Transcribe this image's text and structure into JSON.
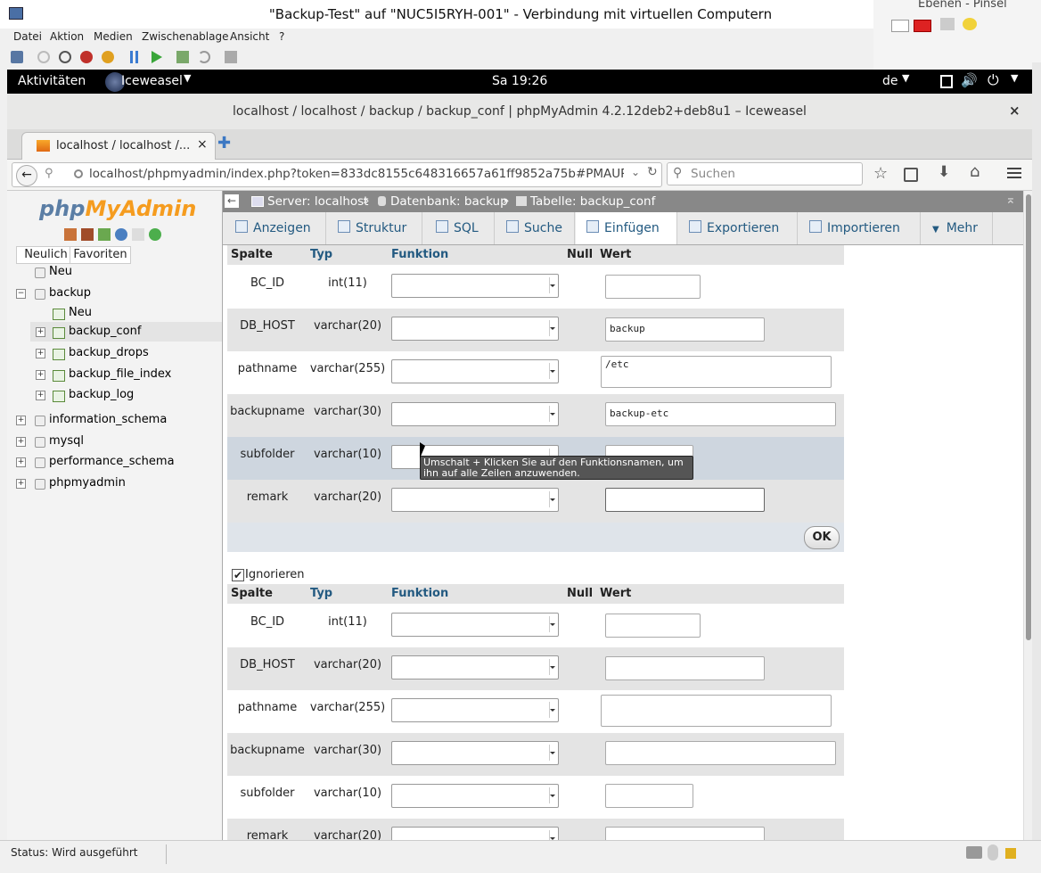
{
  "vm": {
    "title": "\"Backup-Test\" auf \"NUC5I5RYH-001\" - Verbindung mit virtuellen Computern",
    "menu": [
      "Datei",
      "Aktion",
      "Medien",
      "Zwischenablage",
      "Ansicht",
      "?"
    ],
    "side_app_title": "Ebenen - Pinsel",
    "status": "Status: Wird ausgeführt"
  },
  "gnome": {
    "activities": "Aktivitäten",
    "app": "Iceweasel",
    "clock": "Sa 19:26",
    "lang": "de"
  },
  "browser": {
    "title": "localhost / localhost / backup / backup_conf | phpMyAdmin 4.2.12deb2+deb8u1 – Iceweasel",
    "tab_title": "localhost / localhost /...",
    "url": "localhost/phpmyadmin/index.php?token=833dc8155c648316657a61ff9852a75b#PMAURL",
    "search_placeholder": "Suchen"
  },
  "sidebar": {
    "logo_php": "php",
    "logo_ma": "MyAdmin",
    "tab_recent": "Neulich",
    "tab_fav": "Favoriten",
    "tree": {
      "new_db": "Neu",
      "backup": "backup",
      "new_tbl": "Neu",
      "tables": [
        "backup_conf",
        "backup_drops",
        "backup_file_index",
        "backup_log"
      ],
      "other_dbs": [
        "information_schema",
        "mysql",
        "performance_schema",
        "phpmyadmin"
      ]
    }
  },
  "breadcrumb": {
    "server": "Server: localhost",
    "db": "Datenbank: backup",
    "table": "Tabelle: backup_conf"
  },
  "tabs": [
    "Anzeigen",
    "Struktur",
    "SQL",
    "Suche",
    "Einfügen",
    "Exportieren",
    "Importieren",
    "Mehr"
  ],
  "active_tab": "Einfügen",
  "headers": {
    "col": "Spalte",
    "type": "Typ",
    "func": "Funktion",
    "null": "Null",
    "value": "Wert"
  },
  "form1": {
    "rows": [
      {
        "name": "BC_ID",
        "type": "int(11)",
        "value": ""
      },
      {
        "name": "DB_HOST",
        "type": "varchar(20)",
        "value": "backup"
      },
      {
        "name": "pathname",
        "type": "varchar(255)",
        "value": "/etc"
      },
      {
        "name": "backupname",
        "type": "varchar(30)",
        "value": "backup-etc"
      },
      {
        "name": "subfolder",
        "type": "varchar(10)",
        "value": ""
      },
      {
        "name": "remark",
        "type": "varchar(20)",
        "value": ""
      }
    ],
    "ok": "OK"
  },
  "tooltip": "Umschalt + Klicken Sie auf den Funktionsnamen, um ihn auf alle Zeilen anzuwenden.",
  "ignore_label": "Ignorieren",
  "form2": {
    "rows": [
      {
        "name": "BC_ID",
        "type": "int(11)"
      },
      {
        "name": "DB_HOST",
        "type": "varchar(20)"
      },
      {
        "name": "pathname",
        "type": "varchar(255)"
      },
      {
        "name": "backupname",
        "type": "varchar(30)"
      },
      {
        "name": "subfolder",
        "type": "varchar(10)"
      },
      {
        "name": "remark",
        "type": "varchar(20)"
      }
    ]
  },
  "colors": {
    "link": "#235a81",
    "row_alt": "#e4e4e4",
    "row_hover": "#ced6df",
    "crumb_bg": "#888888"
  }
}
